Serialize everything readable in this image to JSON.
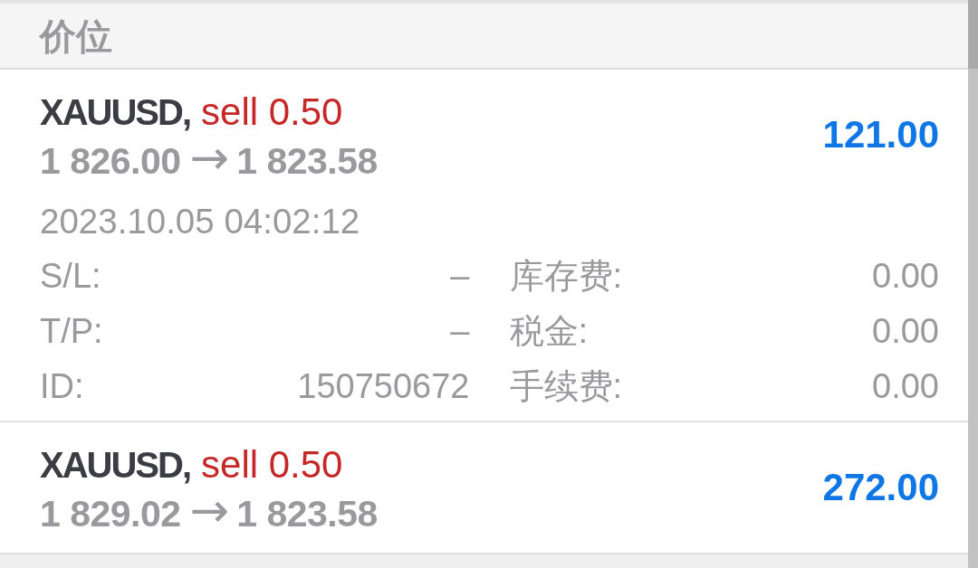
{
  "header": {
    "title": "价位"
  },
  "positions": [
    {
      "symbol": "XAUUSD,",
      "kind": "sell",
      "order": "sell 0.50",
      "open_price": "1 826.00",
      "arrow": "→",
      "current_price": "1 823.58",
      "profit": "121.00",
      "expanded": true,
      "time": "2023.10.05 04:02:12",
      "details": [
        {
          "label": "S/L:",
          "value": "–"
        },
        {
          "label": "库存费:",
          "value": "0.00"
        },
        {
          "label": "T/P:",
          "value": "–"
        },
        {
          "label": "税金:",
          "value": "0.00"
        },
        {
          "label": "ID:",
          "value": "150750672"
        },
        {
          "label": "手续费:",
          "value": "0.00"
        }
      ]
    },
    {
      "symbol": "XAUUSD,",
      "kind": "sell",
      "order": "sell 0.50",
      "open_price": "1 829.02",
      "arrow": "→",
      "current_price": "1 823.58",
      "profit": "272.00",
      "expanded": false
    }
  ]
}
